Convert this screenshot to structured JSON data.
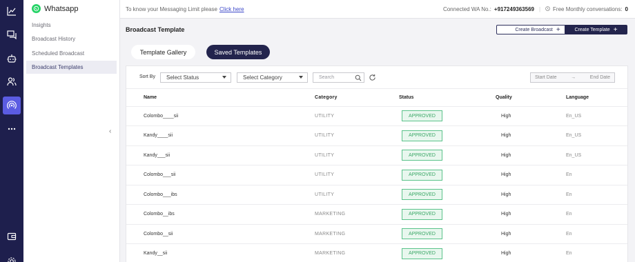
{
  "rail": {
    "icons": [
      "analytics-icon",
      "chat-icon",
      "bot-icon",
      "contacts-icon",
      "broadcast-icon",
      "more-icon",
      "wallet-icon",
      "settings-icon"
    ],
    "active": "broadcast-icon"
  },
  "sidebar": {
    "brand": "Whatsapp",
    "items": [
      {
        "label": "Insights"
      },
      {
        "label": "Broadcast History"
      },
      {
        "label": "Scheduled Broadcast"
      },
      {
        "label": "Broadcast Templates"
      }
    ],
    "active_index": 3
  },
  "topbar": {
    "limit_text": "To know your Messaging Limit please",
    "limit_link": "Click here",
    "wa_label": "Connected WA No.:",
    "wa_number": "+917249363569",
    "free_label": "Free Monthly conversations:",
    "free_value": "0"
  },
  "page": {
    "title": "Broadcast Template",
    "create_broadcast": "Create Broadcast",
    "create_template": "Create Template"
  },
  "tabs": {
    "gallery": "Template Gallery",
    "saved": "Saved Templates",
    "active": "saved"
  },
  "filters": {
    "sort_by": "Sort By",
    "status_value": "Select Status",
    "category_value": "Select Category",
    "search_placeholder": "Search",
    "start_date": "Start Date",
    "end_date": "End Date"
  },
  "table": {
    "columns": [
      "Name",
      "Category",
      "Status",
      "Quality",
      "Language"
    ],
    "rows": [
      {
        "name": "Colombo____sii",
        "category": "UTILITY",
        "status": "APPROVED",
        "quality": "High",
        "language": "En_US"
      },
      {
        "name": "Kandy____sii",
        "category": "UTILITY",
        "status": "APPROVED",
        "quality": "High",
        "language": "En_US"
      },
      {
        "name": "Kandy___sii",
        "category": "UTILITY",
        "status": "APPROVED",
        "quality": "High",
        "language": "En_US"
      },
      {
        "name": "Colombo___sii",
        "category": "UTILITY",
        "status": "APPROVED",
        "quality": "High",
        "language": "En"
      },
      {
        "name": "Colombo___ibs",
        "category": "UTILITY",
        "status": "APPROVED",
        "quality": "High",
        "language": "En"
      },
      {
        "name": "Colombo__ibs",
        "category": "MARKETING",
        "status": "APPROVED",
        "quality": "High",
        "language": "En"
      },
      {
        "name": "Colombo__sii",
        "category": "MARKETING",
        "status": "APPROVED",
        "quality": "High",
        "language": "En"
      },
      {
        "name": "Kandy__sii",
        "category": "MARKETING",
        "status": "APPROVED",
        "quality": "High",
        "language": "En"
      }
    ]
  },
  "colors": {
    "rail": "#1e1f4d",
    "accent": "#5b5ce2",
    "primary_button": "#23244d",
    "approved": "#3aa766"
  }
}
